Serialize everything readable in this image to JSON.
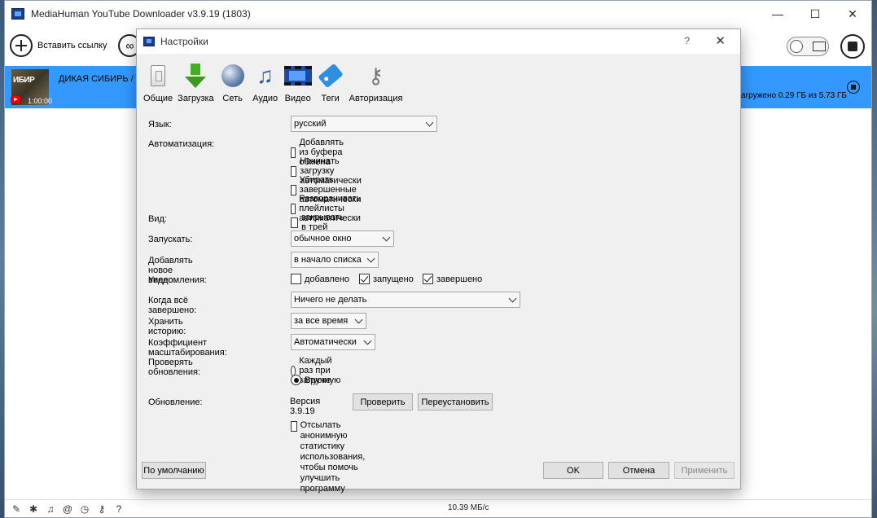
{
  "app": {
    "title": "MediaHuman YouTube Downloader v3.9.19 (1803)",
    "window_buttons": {
      "minimize": "—",
      "maximize": "☐",
      "close": "✕"
    },
    "toolbar": {
      "paste_label": "Вставить ссылку"
    },
    "download": {
      "title": "ДИКАЯ СИБИРЬ / W",
      "thumb_text": "ИБИР",
      "duration": "1:00:00",
      "status": "загружено 0.29 ГБ из 5.73 ГБ"
    },
    "statusbar": {
      "speed": "10.39 МБ/с"
    }
  },
  "dialog": {
    "title": "Настройки",
    "help": "?",
    "close": "✕",
    "tabs": [
      {
        "label": "Общие",
        "icon": "switch-icon"
      },
      {
        "label": "Загрузка",
        "icon": "download-arrow-icon"
      },
      {
        "label": "Сеть",
        "icon": "globe-icon"
      },
      {
        "label": "Аудио",
        "icon": "music-note-icon"
      },
      {
        "label": "Видео",
        "icon": "film-icon"
      },
      {
        "label": "Теги",
        "icon": "tag-icon"
      },
      {
        "label": "Авторизация",
        "icon": "keys-icon"
      }
    ],
    "form": {
      "language_label": "Язык:",
      "language_value": "русский",
      "automation_label": "Автоматизация:",
      "auto_clipboard": "Добавлять из буфера обмена",
      "auto_start": "Начинать загрузку автоматически",
      "auto_remove": "Убирать завершенные автоматически",
      "auto_expand": "Разворачивать плейлисты автоматически",
      "view_label": "Вид:",
      "close_to_tray": "закрывать в трей",
      "launch_label": "Запускать:",
      "launch_value": "обычное окно",
      "add_new_label": "Добавлять новое видео:",
      "add_new_value": "в начало списка",
      "notify_label": "Уведомления:",
      "notify_added": "добавлено",
      "notify_started": "запущено",
      "notify_done": "завершено",
      "when_done_label": "Когда всё завершено:",
      "when_done_value": "Ничего не делать",
      "history_label": "Хранить историю:",
      "history_value": "за все время",
      "scale_label": "Коэффициент масштабирования:",
      "scale_value": "Автоматически",
      "check_updates_label": "Проверять обновления:",
      "check_every_start": "Каждый раз при запуске",
      "check_manual": "Вручную",
      "update_label": "Обновление:",
      "version_text": "Версия 3.9.19",
      "check_button": "Проверить",
      "reinstall_button": "Переустановить",
      "stats_line1": "Отсылать анонимную статистику",
      "stats_line2": "использования, чтобы помочь",
      "stats_line3": "улучшить программу"
    },
    "buttons": {
      "defaults": "По умолчанию",
      "ok": "OK",
      "cancel": "Отмена",
      "apply": "Применить"
    }
  }
}
